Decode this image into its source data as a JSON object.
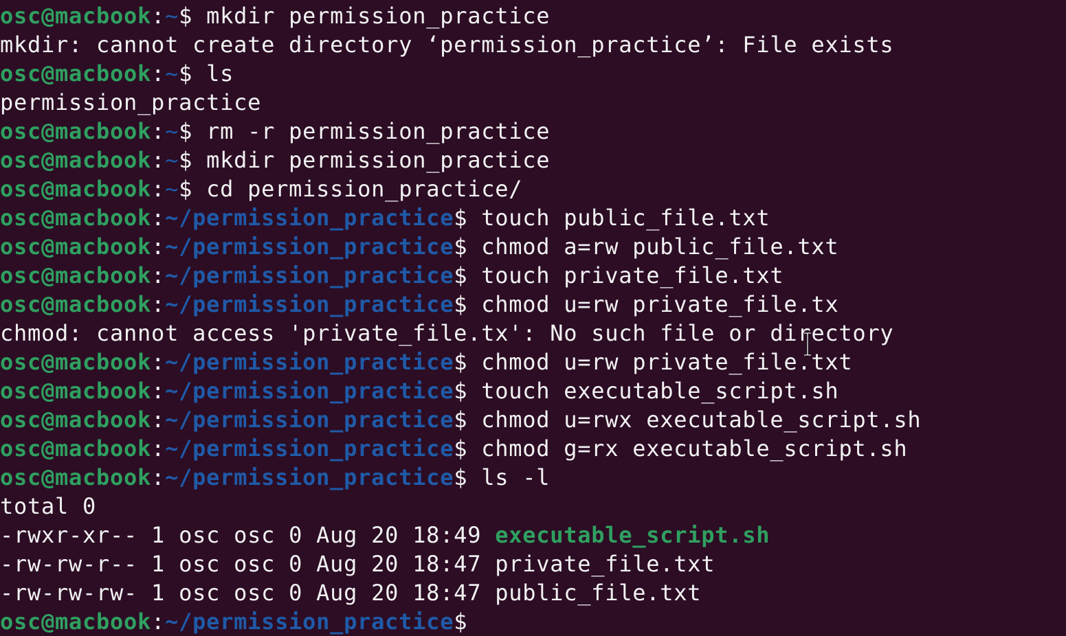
{
  "terminal": {
    "colors": {
      "background": "#2c0d24",
      "prompt_user": "#2fa060",
      "prompt_path": "#1f5aa8",
      "text": "#f2f2f2",
      "executable": "#2fa060"
    },
    "prompt_user": "osc@macbook",
    "lines": [
      {
        "type": "prompt",
        "path": "~",
        "command": "mkdir permission_practice"
      },
      {
        "type": "output",
        "text": "mkdir: cannot create directory ‘permission_practice’: File exists"
      },
      {
        "type": "prompt",
        "path": "~",
        "command": "ls"
      },
      {
        "type": "output",
        "text": "permission_practice"
      },
      {
        "type": "prompt",
        "path": "~",
        "command": "rm -r permission_practice"
      },
      {
        "type": "prompt",
        "path": "~",
        "command": "mkdir permission_practice"
      },
      {
        "type": "prompt",
        "path": "~",
        "command": "cd permission_practice/"
      },
      {
        "type": "prompt",
        "path": "~/permission_practice",
        "command": "touch public_file.txt"
      },
      {
        "type": "prompt",
        "path": "~/permission_practice",
        "command": "chmod a=rw public_file.txt"
      },
      {
        "type": "prompt",
        "path": "~/permission_practice",
        "command": "touch private_file.txt"
      },
      {
        "type": "prompt",
        "path": "~/permission_practice",
        "command": "chmod u=rw private_file.tx"
      },
      {
        "type": "output",
        "text": "chmod: cannot access 'private_file.tx': No such file or directory"
      },
      {
        "type": "prompt",
        "path": "~/permission_practice",
        "command": "chmod u=rw private_file.txt"
      },
      {
        "type": "prompt",
        "path": "~/permission_practice",
        "command": "touch executable_script.sh"
      },
      {
        "type": "prompt",
        "path": "~/permission_practice",
        "command": "chmod u=rwx executable_script.sh"
      },
      {
        "type": "prompt",
        "path": "~/permission_practice",
        "command": "chmod g=rx executable_script.sh"
      },
      {
        "type": "prompt",
        "path": "~/permission_practice",
        "command": "ls -l"
      },
      {
        "type": "output",
        "text": "total 0"
      },
      {
        "type": "listing",
        "meta": "-rwxr-xr-- 1 osc osc 0 Aug 20 18:49 ",
        "name": "executable_script.sh",
        "executable": true
      },
      {
        "type": "listing",
        "meta": "-rw-rw-r-- 1 osc osc 0 Aug 20 18:47 ",
        "name": "private_file.txt",
        "executable": false
      },
      {
        "type": "listing",
        "meta": "-rw-rw-rw- 1 osc osc 0 Aug 20 18:47 ",
        "name": "public_file.txt",
        "executable": false
      },
      {
        "type": "prompt",
        "path": "~/permission_practice",
        "command": ""
      }
    ],
    "pointer_icon": "text-cursor-ibeam-icon"
  }
}
